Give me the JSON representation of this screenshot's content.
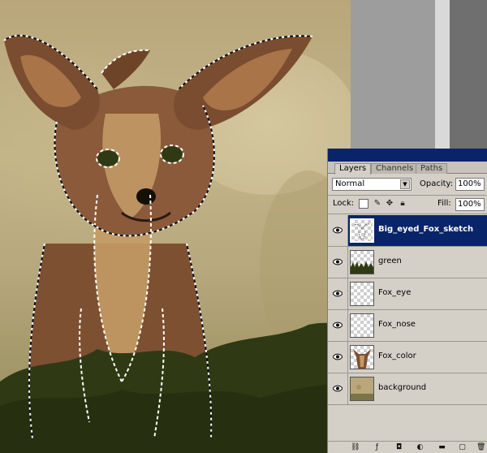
{
  "panel": {
    "tabs": [
      {
        "label": "Layers",
        "active": true
      },
      {
        "label": "Channels",
        "active": false
      },
      {
        "label": "Paths",
        "active": false
      }
    ],
    "blend_mode": "Normal",
    "opacity_label": "Opacity:",
    "opacity_value": "100%",
    "lock_label": "Lock:",
    "fill_label": "Fill:",
    "fill_value": "100%"
  },
  "layers": [
    {
      "name": "Big_eyed_Fox_sketch",
      "selected": true,
      "visible": true,
      "thumb": "sketch"
    },
    {
      "name": "green",
      "selected": false,
      "visible": true,
      "thumb": "grass"
    },
    {
      "name": "Fox_eye",
      "selected": false,
      "visible": true,
      "thumb": "transparent"
    },
    {
      "name": "Fox_nose",
      "selected": false,
      "visible": true,
      "thumb": "transparent"
    },
    {
      "name": "Fox_color",
      "selected": false,
      "visible": true,
      "thumb": "fox"
    },
    {
      "name": "background",
      "selected": false,
      "visible": true,
      "thumb": "tan"
    }
  ],
  "colors": {
    "selection_highlight": "#0a246a",
    "panel_bg": "#d4d0c8",
    "fox_fur": "#8a5a3a",
    "grass": "#2f3a14"
  },
  "icons": {
    "lock_row": [
      "lock-transparent-icon",
      "lock-paint-icon",
      "lock-move-icon",
      "lock-all-icon"
    ],
    "bottom_bar": [
      "link-icon",
      "layer-style-icon",
      "mask-icon",
      "adjustment-icon",
      "group-icon",
      "new-layer-icon",
      "trash-icon"
    ]
  }
}
